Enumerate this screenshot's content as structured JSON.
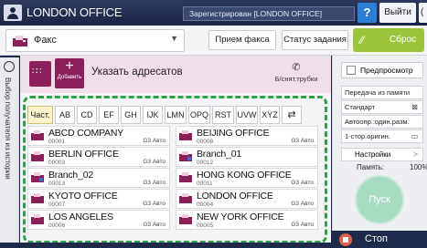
{
  "topbar": {
    "title": "LONDON OFFICE",
    "login_status": "Зарегистрирован [LONDON OFFICE]",
    "help": "?",
    "logout": "Выйти",
    "extra": "("
  },
  "toolbar": {
    "app": "Факс",
    "receive": "Прием факса",
    "job_status": "Статус задания",
    "reset": "Сброс"
  },
  "side_tab": {
    "label": "Выбор получателя из истории"
  },
  "address_header": {
    "add_label": "Добавить",
    "title": "Указать адресатов",
    "hook": "Б/снят.трубки"
  },
  "tabs": [
    "Част.",
    "AB",
    "CD",
    "EF",
    "GH",
    "IJK",
    "LMN",
    "OPQ",
    "RST",
    "UVW",
    "XYZ",
    "⇄"
  ],
  "entries": [
    {
      "name": "ABCD COMPANY",
      "number": "00001",
      "type": "G3 Авто"
    },
    {
      "name": "BEIJING OFFICE",
      "number": "00008",
      "type": "G3 Авто"
    },
    {
      "name": "BERLIN OFFICE",
      "number": "00003",
      "type": "G3 Авто"
    },
    {
      "name": "Branch_01",
      "number": "00012",
      "type": ""
    },
    {
      "name": "Branch_02",
      "number": "00013",
      "type": "G3 Авто"
    },
    {
      "name": "HONG KONG OFFICE",
      "number": "00011",
      "type": "G3 Авто"
    },
    {
      "name": "KYOTO OFFICE",
      "number": "00007",
      "type": "G3 Авто"
    },
    {
      "name": "LONDON OFFICE",
      "number": "00004",
      "type": "G3 Авто"
    },
    {
      "name": "LOS ANGELES",
      "number": "00006",
      "type": "G3 Авто"
    },
    {
      "name": "NEW YORK OFFICE",
      "number": "00005",
      "type": "G3 Авто"
    }
  ],
  "right_panel": {
    "preview": "Предпросмотр",
    "options": [
      "Передача из памяти",
      "Стандарт",
      "Автоопр.:один.разм.",
      "1-стор.оригин."
    ],
    "settings": "Настройки",
    "memory_label": "Память:",
    "memory_value": "100%",
    "start": "Пуск",
    "stop": "Стоп"
  },
  "colors": {
    "accent_magenta": "#8a1f5a",
    "reset_green": "#9bc43a",
    "dash_green": "#2da24a",
    "start_mint": "#a8dcc2",
    "header_navy": "#1e2a4a"
  }
}
